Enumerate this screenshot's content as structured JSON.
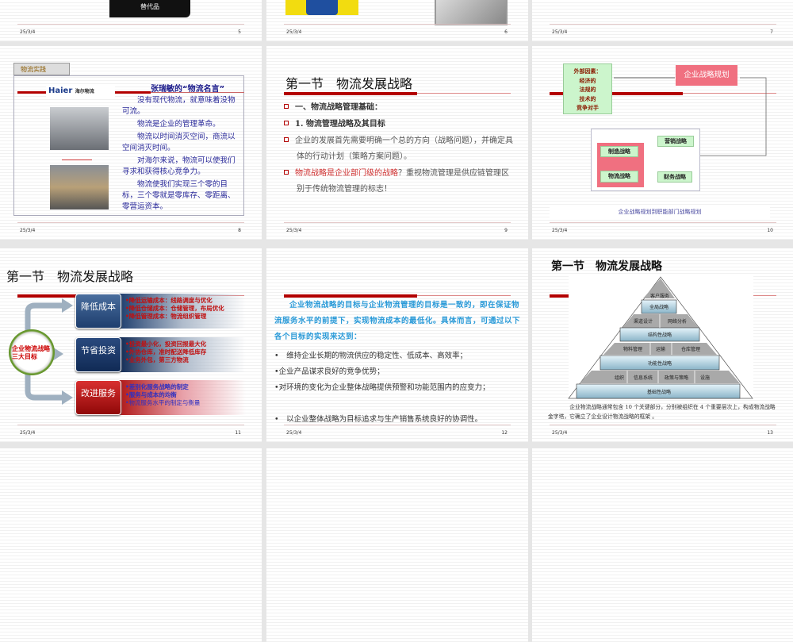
{
  "slides": [
    {
      "num": "5",
      "date": "25/3/4",
      "box_label": "替代品"
    },
    {
      "num": "6",
      "date": "25/3/4"
    },
    {
      "num": "7",
      "date": "25/3/4"
    },
    {
      "num": "8",
      "date": "25/3/4",
      "tab": "物流实践",
      "logo_text": "Haier",
      "logo_cn": "海尔物流",
      "heading": "张瑞敏的“物流名言”",
      "quotes": [
        "没有现代物流，就意味着没物可流。",
        "物流是企业的管理革命。",
        "物流以时间消灭空间，商流以空间消灭时间。",
        "对海尔来说，物流可以使我们寻求和获得核心竞争力。",
        "物流使我们实现三个零的目标，三个零就是零库存、零距离、零营运资本。"
      ]
    },
    {
      "num": "9",
      "date": "25/3/4",
      "title": "第一节　物流发展战略",
      "bullets": [
        "一、物流战略管理基础：",
        "1. 物流管理战略及其目标",
        "企业的发展首先需要明确一个总的方向（战略问题），并确定具体的行动计划（策略方案问题）。"
      ],
      "bullet4_red": "物流战略是企业部门级的战略",
      "bullet4_rest": "？重视物流管理是供应链管理区别于传统物流管理的标志！"
    },
    {
      "num": "10",
      "date": "25/3/4",
      "external": [
        "外部因素：",
        "经济的",
        "法规的",
        "技术的",
        "竞争对手"
      ],
      "plan": "企业战略规划",
      "functions": {
        "manufacturing": "制造战略",
        "logistics": "物流战略",
        "marketing": "营销战略",
        "finance": "财务战略"
      },
      "caption": "企业战略规划到职能部门战略规划"
    },
    {
      "num": "11",
      "date": "25/3/4",
      "title": "第一节　物流发展战略",
      "center": "企业物流战略三大目标",
      "goals": [
        {
          "label": "降低成本",
          "items": [
            "•降低运输成本：线路调度与优化",
            "•降低仓储成本：仓储管理，布局优化",
            "•降低管理成本：物流组织管理"
          ]
        },
        {
          "label": "节省投资",
          "items": [
            "•投资最小化，投资回报最大化",
            "•外协仓库，准时配送降低库存",
            "•业务外包，第三方物流"
          ]
        },
        {
          "label": "改进服务",
          "items": [
            "•差别化服务战略的制定",
            "•服务与成本的均衡",
            "•物流服务水平的制定与衡量"
          ]
        }
      ]
    },
    {
      "num": "12",
      "date": "25/3/4",
      "intro": "企业物流战略的目标与企业物流管理的目标是一致的，即在保证物流服务水平的前提下，实现物流成本的最低化。具体而言，可通过以下各个目标的实现来达到：",
      "points": [
        "•　维持企业长期的物流供应的稳定性、低成本、高效率；",
        "•企业产品谋求良好的竞争优势；",
        "•对环境的变化为企业整体战略提供预警和功能范围内的应变力；",
        "•　以企业整体战略为目标追求与生产销售系统良好的协调性。"
      ]
    },
    {
      "num": "13",
      "date": "25/3/4",
      "title": "第一节　物流发展战略",
      "pyramid": {
        "top": "客户服务",
        "global": "全局战略",
        "channel": "渠道设计",
        "network": "网络分析",
        "structural": "结构性战略",
        "material": "物料管理",
        "transport": "运输",
        "warehouse": "仓库管理",
        "functional": "功能性战略",
        "org": "组织",
        "info": "信息系统",
        "policy": "政策与策略",
        "facility": "设施",
        "foundation": "基础性战略"
      },
      "caption": "企业物流战略通常包含 10 个关键部分，分别被组织在 4 个重要层次上，构成物流战略金字塔，它确立了企业设计物流战略的框架 。"
    }
  ]
}
